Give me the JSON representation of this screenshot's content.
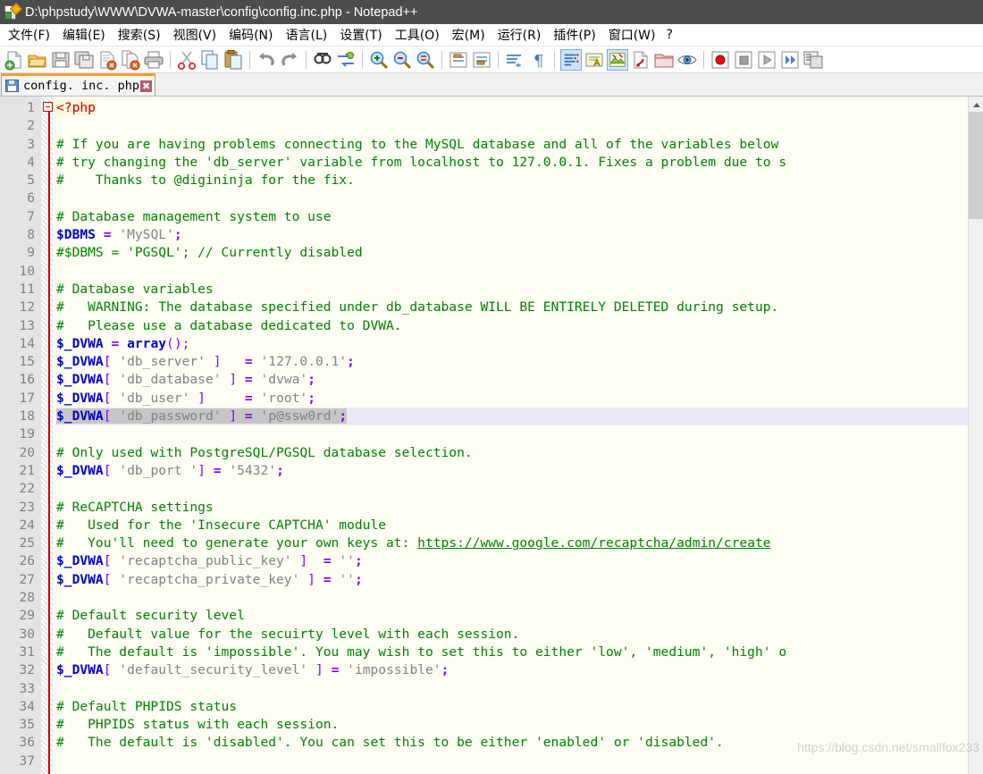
{
  "window": {
    "title": "D:\\phpstudy\\WWW\\DVWA-master\\config\\config.inc.php - Notepad++",
    "app_icon": "notepad-plus-plus-icon"
  },
  "menubar": {
    "items": [
      {
        "label": "文件(F)",
        "name": "menu-file"
      },
      {
        "label": "编辑(E)",
        "name": "menu-edit"
      },
      {
        "label": "搜索(S)",
        "name": "menu-search"
      },
      {
        "label": "视图(V)",
        "name": "menu-view"
      },
      {
        "label": "编码(N)",
        "name": "menu-encoding"
      },
      {
        "label": "语言(L)",
        "name": "menu-language"
      },
      {
        "label": "设置(T)",
        "name": "menu-settings"
      },
      {
        "label": "工具(O)",
        "name": "menu-tools"
      },
      {
        "label": "宏(M)",
        "name": "menu-macro"
      },
      {
        "label": "运行(R)",
        "name": "menu-run"
      },
      {
        "label": "插件(P)",
        "name": "menu-plugins"
      },
      {
        "label": "窗口(W)",
        "name": "menu-window"
      },
      {
        "label": "?",
        "name": "menu-help"
      }
    ]
  },
  "toolbar": {
    "buttons": [
      {
        "name": "new-file-icon",
        "tip": "新建"
      },
      {
        "name": "open-file-icon",
        "tip": "打开"
      },
      {
        "name": "save-icon",
        "tip": "保存"
      },
      {
        "name": "save-all-icon",
        "tip": "保存所有"
      },
      {
        "name": "close-file-icon",
        "tip": "关闭"
      },
      {
        "name": "close-all-files-icon",
        "tip": "关闭所有"
      },
      {
        "name": "print-icon",
        "tip": "打印"
      },
      {
        "name": "separator-1",
        "tip": ""
      },
      {
        "name": "cut-icon",
        "tip": "剪切"
      },
      {
        "name": "copy-icon",
        "tip": "复制"
      },
      {
        "name": "paste-icon",
        "tip": "粘贴"
      },
      {
        "name": "separator-2",
        "tip": ""
      },
      {
        "name": "undo-icon",
        "tip": "撤销"
      },
      {
        "name": "redo-icon",
        "tip": "重做"
      },
      {
        "name": "separator-3",
        "tip": ""
      },
      {
        "name": "find-icon",
        "tip": "查找"
      },
      {
        "name": "replace-icon",
        "tip": "替换"
      },
      {
        "name": "separator-4",
        "tip": ""
      },
      {
        "name": "zoom-in-icon",
        "tip": "放大"
      },
      {
        "name": "zoom-out-icon",
        "tip": "缩小"
      },
      {
        "name": "sync-scroll-icon",
        "tip": "同步滚动"
      },
      {
        "name": "separator-5",
        "tip": ""
      },
      {
        "name": "word-wrap-icon",
        "tip": "自动换行"
      },
      {
        "name": "show-all-chars-icon",
        "tip": "显示所有字符"
      },
      {
        "name": "separator-6",
        "tip": ""
      },
      {
        "name": "show-indent-guide-icon",
        "tip": "显示缩进参考线"
      },
      {
        "name": "pilcrow-icon",
        "tip": "显示段落符号"
      },
      {
        "name": "separator-7",
        "tip": ""
      },
      {
        "name": "show-whitespace-icon",
        "tip": "显示空白符",
        "active": true
      },
      {
        "name": "user-defined-lang-icon",
        "tip": "用户自定义语言"
      },
      {
        "name": "document-map-icon",
        "tip": "文档地图",
        "active": true
      },
      {
        "name": "function-list-icon",
        "tip": "函数列表"
      },
      {
        "name": "folder-as-workspace-icon",
        "tip": "文件夹作为工作区"
      },
      {
        "name": "monitor-icon",
        "tip": "监视"
      },
      {
        "name": "separator-8",
        "tip": ""
      },
      {
        "name": "macro-record-icon",
        "tip": "录制宏"
      },
      {
        "name": "macro-stop-icon",
        "tip": "停止录制"
      },
      {
        "name": "macro-play-icon",
        "tip": "播放宏"
      },
      {
        "name": "macro-run-multiple-icon",
        "tip": "多次运行宏"
      },
      {
        "name": "macro-save-icon",
        "tip": "保存当前宏"
      }
    ]
  },
  "tabs": [
    {
      "label": "config. inc. php",
      "name": "tab-config-inc-php",
      "close": "✖",
      "active": true
    }
  ],
  "editor": {
    "first_line": 1,
    "total_visible_lines": 37,
    "current_line": 18,
    "selection_line": 18,
    "background_color": "#fffef5",
    "gutter_color": "#e4e4e4",
    "current_line_color": "#e8e8f8",
    "selection_color": "#c6c6c6",
    "fold_marker_color": "#cc0000",
    "lines": [
      {
        "n": 1,
        "tokens": [
          {
            "t": "<?php",
            "c": "tok-php-tag"
          }
        ]
      },
      {
        "n": 2,
        "tokens": []
      },
      {
        "n": 3,
        "tokens": [
          {
            "t": "# If you are having problems connecting to the MySQL database and all of the variables below",
            "c": "tok-comment"
          }
        ]
      },
      {
        "n": 4,
        "tokens": [
          {
            "t": "# try changing the 'db_server' variable from localhost to 127.0.0.1. Fixes a problem due to s",
            "c": "tok-comment"
          }
        ]
      },
      {
        "n": 5,
        "tokens": [
          {
            "t": "#    Thanks to @digininja for the fix.",
            "c": "tok-comment"
          }
        ]
      },
      {
        "n": 6,
        "tokens": []
      },
      {
        "n": 7,
        "tokens": [
          {
            "t": "# Database management system to use",
            "c": "tok-comment"
          }
        ]
      },
      {
        "n": 8,
        "tokens": [
          {
            "t": "$DBMS",
            "c": "tok-var"
          },
          {
            "t": " ",
            "c": "tok-plain"
          },
          {
            "t": "=",
            "c": "tok-op"
          },
          {
            "t": " ",
            "c": "tok-plain"
          },
          {
            "t": "'MySQL'",
            "c": "tok-string"
          },
          {
            "t": ";",
            "c": "tok-op"
          }
        ]
      },
      {
        "n": 9,
        "tokens": [
          {
            "t": "#$DBMS = 'PGSQL'; // Currently disabled",
            "c": "tok-comment"
          }
        ]
      },
      {
        "n": 10,
        "tokens": []
      },
      {
        "n": 11,
        "tokens": [
          {
            "t": "# Database variables",
            "c": "tok-comment"
          }
        ]
      },
      {
        "n": 12,
        "tokens": [
          {
            "t": "#   WARNING: The database specified under db_database WILL BE ENTIRELY DELETED during setup.",
            "c": "tok-comment"
          }
        ]
      },
      {
        "n": 13,
        "tokens": [
          {
            "t": "#   Please use a database dedicated to DVWA.",
            "c": "tok-comment"
          }
        ]
      },
      {
        "n": 14,
        "tokens": [
          {
            "t": "$_DVWA",
            "c": "tok-var"
          },
          {
            "t": " ",
            "c": "tok-plain"
          },
          {
            "t": "=",
            "c": "tok-op"
          },
          {
            "t": " ",
            "c": "tok-plain"
          },
          {
            "t": "array",
            "c": "tok-kw"
          },
          {
            "t": "();",
            "c": "tok-bracket"
          }
        ]
      },
      {
        "n": 15,
        "tokens": [
          {
            "t": "$_DVWA",
            "c": "tok-var"
          },
          {
            "t": "[",
            "c": "tok-bracket"
          },
          {
            "t": " 'db_server' ",
            "c": "tok-string"
          },
          {
            "t": "]",
            "c": "tok-bracket"
          },
          {
            "t": "   ",
            "c": "tok-plain"
          },
          {
            "t": "=",
            "c": "tok-op"
          },
          {
            "t": " ",
            "c": "tok-plain"
          },
          {
            "t": "'127.0.0.1'",
            "c": "tok-string"
          },
          {
            "t": ";",
            "c": "tok-op"
          }
        ]
      },
      {
        "n": 16,
        "tokens": [
          {
            "t": "$_DVWA",
            "c": "tok-var"
          },
          {
            "t": "[",
            "c": "tok-bracket"
          },
          {
            "t": " 'db_database' ",
            "c": "tok-string"
          },
          {
            "t": "]",
            "c": "tok-bracket"
          },
          {
            "t": " ",
            "c": "tok-plain"
          },
          {
            "t": "=",
            "c": "tok-op"
          },
          {
            "t": " ",
            "c": "tok-plain"
          },
          {
            "t": "'dvwa'",
            "c": "tok-string"
          },
          {
            "t": ";",
            "c": "tok-op"
          }
        ]
      },
      {
        "n": 17,
        "tokens": [
          {
            "t": "$_DVWA",
            "c": "tok-var"
          },
          {
            "t": "[",
            "c": "tok-bracket"
          },
          {
            "t": " 'db_user' ",
            "c": "tok-string"
          },
          {
            "t": "]",
            "c": "tok-bracket"
          },
          {
            "t": "     ",
            "c": "tok-plain"
          },
          {
            "t": "=",
            "c": "tok-op"
          },
          {
            "t": " ",
            "c": "tok-plain"
          },
          {
            "t": "'root'",
            "c": "tok-string"
          },
          {
            "t": ";",
            "c": "tok-op"
          }
        ]
      },
      {
        "n": 18,
        "tokens": [
          {
            "t": "$_DVWA",
            "c": "tok-var sel"
          },
          {
            "t": "[",
            "c": "tok-bracket sel"
          },
          {
            "t": " 'db_password' ",
            "c": "tok-string sel"
          },
          {
            "t": "]",
            "c": "tok-bracket sel"
          },
          {
            "t": " ",
            "c": "tok-plain sel"
          },
          {
            "t": "=",
            "c": "tok-op sel"
          },
          {
            "t": " ",
            "c": "tok-plain sel"
          },
          {
            "t": "'p@ssw0rd'",
            "c": "tok-string sel"
          },
          {
            "t": ";",
            "c": "tok-op sel"
          }
        ]
      },
      {
        "n": 19,
        "tokens": []
      },
      {
        "n": 20,
        "tokens": [
          {
            "t": "# Only used with PostgreSQL/PGSQL database selection.",
            "c": "tok-comment"
          }
        ]
      },
      {
        "n": 21,
        "tokens": [
          {
            "t": "$_DVWA",
            "c": "tok-var"
          },
          {
            "t": "[",
            "c": "tok-bracket"
          },
          {
            "t": " 'db_port '",
            "c": "tok-string"
          },
          {
            "t": "]",
            "c": "tok-bracket"
          },
          {
            "t": " ",
            "c": "tok-plain"
          },
          {
            "t": "=",
            "c": "tok-op"
          },
          {
            "t": " ",
            "c": "tok-plain"
          },
          {
            "t": "'5432'",
            "c": "tok-string"
          },
          {
            "t": ";",
            "c": "tok-op"
          }
        ]
      },
      {
        "n": 22,
        "tokens": []
      },
      {
        "n": 23,
        "tokens": [
          {
            "t": "# ReCAPTCHA settings",
            "c": "tok-comment"
          }
        ]
      },
      {
        "n": 24,
        "tokens": [
          {
            "t": "#   Used for the 'Insecure CAPTCHA' module",
            "c": "tok-comment"
          }
        ]
      },
      {
        "n": 25,
        "tokens": [
          {
            "t": "#   You'll need to generate your own keys at: ",
            "c": "tok-comment"
          },
          {
            "t": "https://www.google.com/recaptcha/admin/create",
            "c": "tok-comment-url"
          }
        ]
      },
      {
        "n": 26,
        "tokens": [
          {
            "t": "$_DVWA",
            "c": "tok-var"
          },
          {
            "t": "[",
            "c": "tok-bracket"
          },
          {
            "t": " 'recaptcha_public_key' ",
            "c": "tok-string"
          },
          {
            "t": "]",
            "c": "tok-bracket"
          },
          {
            "t": "  ",
            "c": "tok-plain"
          },
          {
            "t": "=",
            "c": "tok-op"
          },
          {
            "t": " ",
            "c": "tok-plain"
          },
          {
            "t": "''",
            "c": "tok-string"
          },
          {
            "t": ";",
            "c": "tok-op"
          }
        ]
      },
      {
        "n": 27,
        "tokens": [
          {
            "t": "$_DVWA",
            "c": "tok-var"
          },
          {
            "t": "[",
            "c": "tok-bracket"
          },
          {
            "t": " 'recaptcha_private_key' ",
            "c": "tok-string"
          },
          {
            "t": "]",
            "c": "tok-bracket"
          },
          {
            "t": " ",
            "c": "tok-plain"
          },
          {
            "t": "=",
            "c": "tok-op"
          },
          {
            "t": " ",
            "c": "tok-plain"
          },
          {
            "t": "''",
            "c": "tok-string"
          },
          {
            "t": ";",
            "c": "tok-op"
          }
        ]
      },
      {
        "n": 28,
        "tokens": []
      },
      {
        "n": 29,
        "tokens": [
          {
            "t": "# Default security level",
            "c": "tok-comment"
          }
        ]
      },
      {
        "n": 30,
        "tokens": [
          {
            "t": "#   Default value for the secuirty level with each session.",
            "c": "tok-comment"
          }
        ]
      },
      {
        "n": 31,
        "tokens": [
          {
            "t": "#   The default is 'impossible'. You may wish to set this to either 'low', 'medium', 'high' o",
            "c": "tok-comment"
          }
        ]
      },
      {
        "n": 32,
        "tokens": [
          {
            "t": "$_DVWA",
            "c": "tok-var"
          },
          {
            "t": "[",
            "c": "tok-bracket"
          },
          {
            "t": " 'default_security_level' ",
            "c": "tok-string"
          },
          {
            "t": "]",
            "c": "tok-bracket"
          },
          {
            "t": " ",
            "c": "tok-plain"
          },
          {
            "t": "=",
            "c": "tok-op"
          },
          {
            "t": " ",
            "c": "tok-plain"
          },
          {
            "t": "'impossible'",
            "c": "tok-string"
          },
          {
            "t": ";",
            "c": "tok-op"
          }
        ]
      },
      {
        "n": 33,
        "tokens": []
      },
      {
        "n": 34,
        "tokens": [
          {
            "t": "# Default PHPIDS status",
            "c": "tok-comment"
          }
        ]
      },
      {
        "n": 35,
        "tokens": [
          {
            "t": "#   PHPIDS status with each session.",
            "c": "tok-comment"
          }
        ]
      },
      {
        "n": 36,
        "tokens": [
          {
            "t": "#   The default is 'disabled'. You can set this to be either 'enabled' or 'disabled'.",
            "c": "tok-comment"
          }
        ]
      },
      {
        "n": 37,
        "tokens": []
      }
    ]
  },
  "watermark": "https://blog.csdn.net/smallfox233"
}
